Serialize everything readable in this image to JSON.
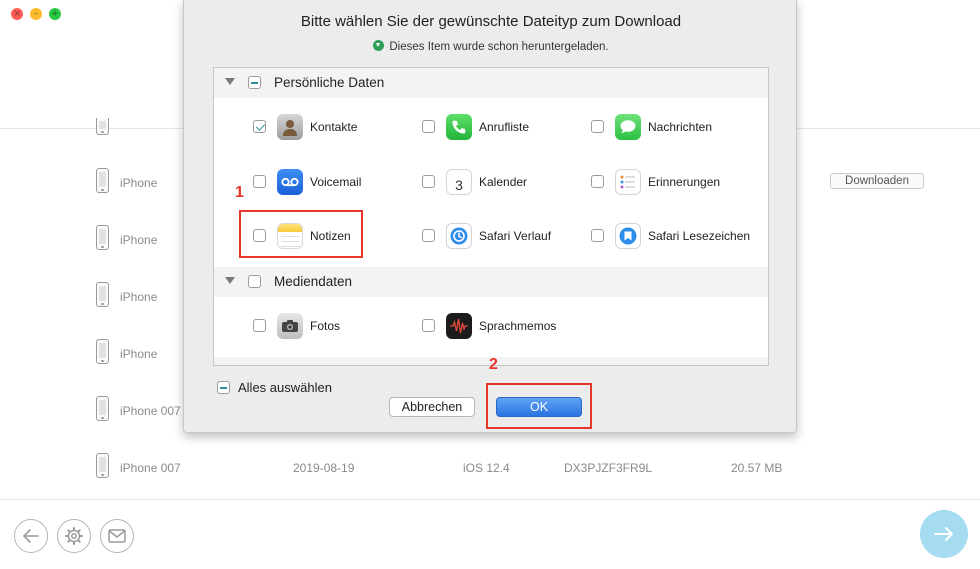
{
  "window": {
    "controls": {
      "close": "×",
      "minimize": "–",
      "zoom": "+"
    }
  },
  "background_rows": [
    {
      "device": "iPhone"
    },
    {
      "device": "iPhone"
    },
    {
      "device": "iPhone"
    },
    {
      "device": "iPhone"
    },
    {
      "device": "iPhone 007"
    },
    {
      "device": "iPhone 007",
      "date": "2019-08-19",
      "ios": "iOS 12.4",
      "serial": "DX3PJZF3FR9L",
      "size": "20.57 MB"
    }
  ],
  "download_button_label": "Downloaden",
  "dialog": {
    "title": "Bitte wählen Sie der gewünschte Dateityp zum Download",
    "subtitle": "Dieses Item wurde schon heruntergeladen.",
    "sections": [
      {
        "label": "Persönliche Daten",
        "state": "partial",
        "items": [
          {
            "label": "Kontakte",
            "checked": true,
            "icon": "contacts-icon"
          },
          {
            "label": "Anrufliste",
            "checked": false,
            "icon": "phone-icon"
          },
          {
            "label": "Nachrichten",
            "checked": false,
            "icon": "messages-icon"
          },
          {
            "label": "Voicemail",
            "checked": false,
            "icon": "voicemail-icon"
          },
          {
            "label": "Kalender",
            "checked": false,
            "icon": "calendar-icon",
            "calendar_day": "3"
          },
          {
            "label": "Erinnerungen",
            "checked": false,
            "icon": "reminders-icon"
          },
          {
            "label": "Notizen",
            "checked": false,
            "icon": "notes-icon"
          },
          {
            "label": "Safari Verlauf",
            "checked": false,
            "icon": "safari-history-icon"
          },
          {
            "label": "Safari Lesezeichen",
            "checked": false,
            "icon": "safari-bookmarks-icon"
          }
        ]
      },
      {
        "label": "Mediendaten",
        "state": "unchecked",
        "items": [
          {
            "label": "Fotos",
            "checked": false,
            "icon": "camera-icon"
          },
          {
            "label": "Sprachmemos",
            "checked": false,
            "icon": "voice-memos-icon"
          }
        ]
      }
    ],
    "select_all_label": "Alles auswählen",
    "cancel_label": "Abbrechen",
    "ok_label": "OK"
  },
  "annotations": {
    "step1": "1",
    "step2": "2"
  },
  "colors": {
    "annotation_red": "#e8362b",
    "ok_blue": "#2a73e0",
    "next_button": "#a6dcf0",
    "checkbox_teal": "#2c8f9a"
  }
}
